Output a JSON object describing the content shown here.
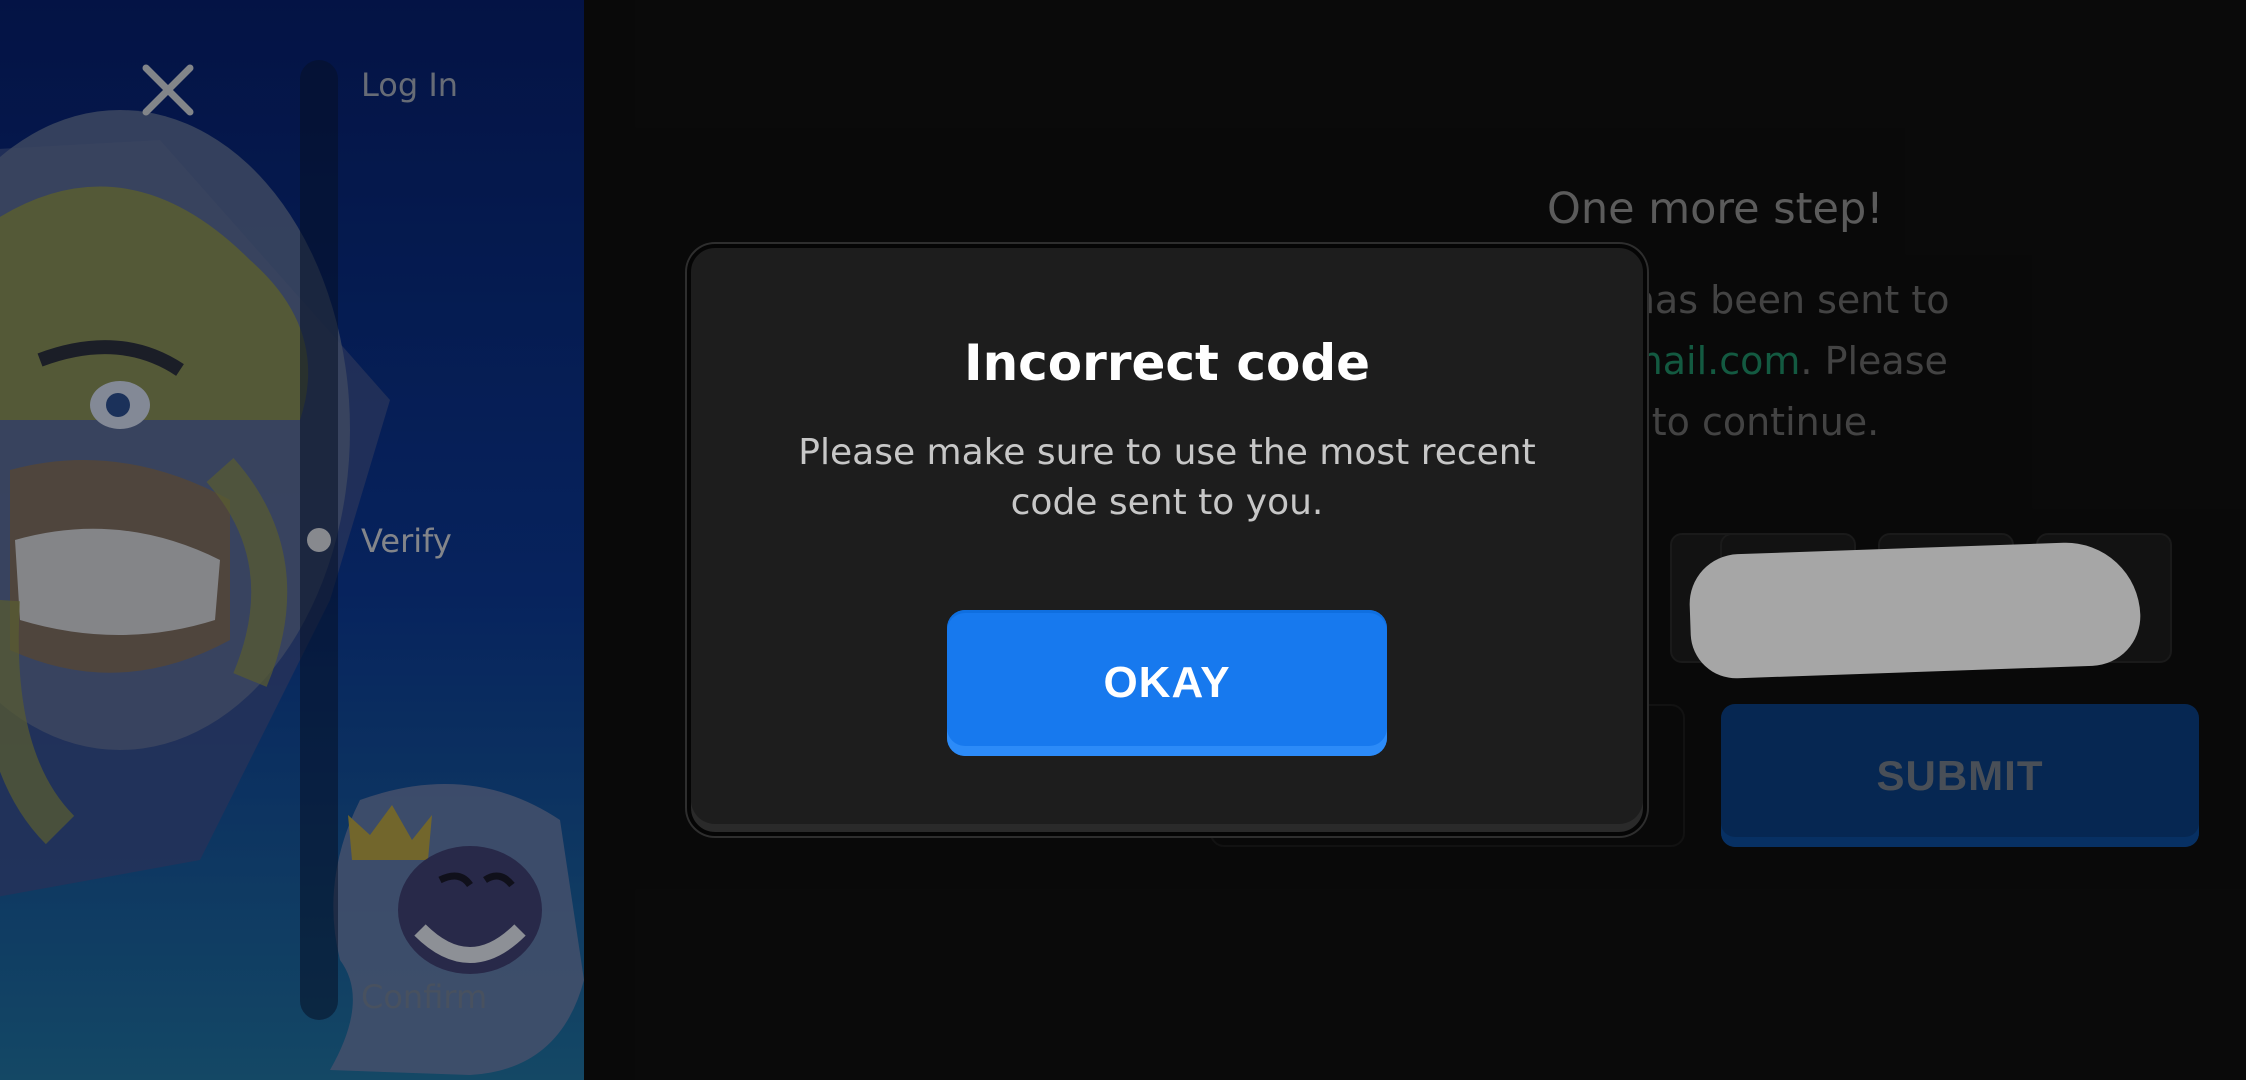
{
  "steps": {
    "login": "Log In",
    "verify": "Verify",
    "confirm": "Confirm"
  },
  "verification": {
    "title": "One more step!",
    "body_line1": "ode has been sent to",
    "email_fragment": "r@gmail.com",
    "body_line2_rest": ". Please",
    "body_line3": "code to continue.",
    "email_color": "#1e8a64"
  },
  "submit_label": "SUBMIT",
  "dialog": {
    "title": "Incorrect code",
    "message": "Please make sure to use the most recent code sent to you.",
    "button_label": "OKAY",
    "button_color": "#1779ee"
  },
  "icons": {
    "close": "close-icon",
    "hero_art": "barbarian-character-art",
    "king_art": "laughing-king-emote-art"
  }
}
